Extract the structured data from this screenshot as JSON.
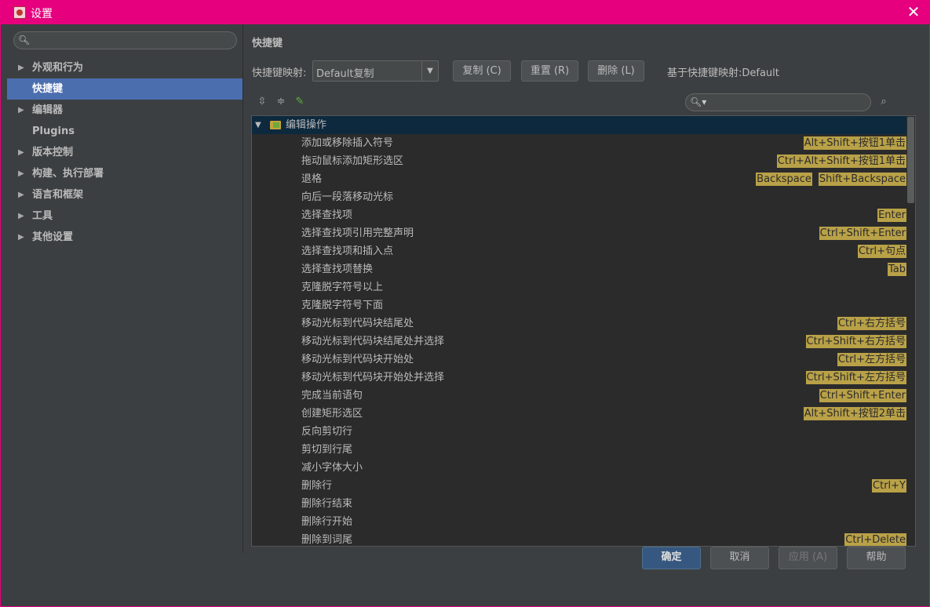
{
  "window": {
    "title": "设置"
  },
  "sidebar": {
    "search_placeholder": "",
    "items": [
      {
        "label": "外观和行为",
        "expandable": true
      },
      {
        "label": "快捷键",
        "expandable": false,
        "selected": true
      },
      {
        "label": "编辑器",
        "expandable": true
      },
      {
        "label": "Plugins",
        "expandable": false
      },
      {
        "label": "版本控制",
        "expandable": true
      },
      {
        "label": "构建、执行部署",
        "expandable": true
      },
      {
        "label": "语言和框架",
        "expandable": true
      },
      {
        "label": "工具",
        "expandable": true
      },
      {
        "label": "其他设置",
        "expandable": true
      }
    ]
  },
  "main": {
    "title": "快捷键",
    "keymap_label": "快捷键映射:",
    "keymap_value": "Default复制",
    "copy_label": "复制 (C)",
    "reset_label": "重置 (R)",
    "delete_label": "删除 (L)",
    "based_on": "基于快捷键映射:Default",
    "filter_placeholder": "",
    "tree": {
      "group": "编辑操作",
      "rows": [
        {
          "label": "添加或移除插入符号",
          "shortcuts": [
            "Alt+Shift+按钮1单击"
          ]
        },
        {
          "label": "拖动鼠标添加矩形选区",
          "shortcuts": [
            "Ctrl+Alt+Shift+按钮1单击"
          ]
        },
        {
          "label": "退格",
          "shortcuts": [
            "Backspace",
            "Shift+Backspace"
          ]
        },
        {
          "label": "向后一段落移动光标",
          "shortcuts": []
        },
        {
          "label": "选择查找项",
          "shortcuts": [
            "Enter"
          ]
        },
        {
          "label": "选择查找项引用完整声明",
          "shortcuts": [
            "Ctrl+Shift+Enter"
          ]
        },
        {
          "label": "选择查找项和插入点",
          "shortcuts": [
            "Ctrl+句点"
          ]
        },
        {
          "label": "选择查找项替换",
          "shortcuts": [
            "Tab"
          ]
        },
        {
          "label": "克隆脱字符号以上",
          "shortcuts": []
        },
        {
          "label": "克隆脱字符号下面",
          "shortcuts": []
        },
        {
          "label": "移动光标到代码块结尾处",
          "shortcuts": [
            "Ctrl+右方括号"
          ]
        },
        {
          "label": "移动光标到代码块结尾处并选择",
          "shortcuts": [
            "Ctrl+Shift+右方括号"
          ]
        },
        {
          "label": "移动光标到代码块开始处",
          "shortcuts": [
            "Ctrl+左方括号"
          ]
        },
        {
          "label": "移动光标到代码块开始处并选择",
          "shortcuts": [
            "Ctrl+Shift+左方括号"
          ]
        },
        {
          "label": "完成当前语句",
          "shortcuts": [
            "Ctrl+Shift+Enter"
          ]
        },
        {
          "label": "创建矩形选区",
          "shortcuts": [
            "Alt+Shift+按钮2单击"
          ]
        },
        {
          "label": "反向剪切行",
          "shortcuts": []
        },
        {
          "label": "剪切到行尾",
          "shortcuts": []
        },
        {
          "label": "减小字体大小",
          "shortcuts": []
        },
        {
          "label": "删除行",
          "shortcuts": [
            "Ctrl+Y"
          ]
        },
        {
          "label": "删除行结束",
          "shortcuts": []
        },
        {
          "label": "删除行开始",
          "shortcuts": []
        },
        {
          "label": "删除到词尾",
          "shortcuts": [
            "Ctrl+Delete"
          ]
        }
      ]
    }
  },
  "footer": {
    "ok_label": "确定",
    "cancel_label": "取消",
    "apply_label": "应用 (A)",
    "help_label": "帮助"
  },
  "colors": {
    "title_bar": "#e6007e",
    "selection": "#4b6eaf",
    "shortcut_badge": "#b9a147",
    "group_row": "#0d293e"
  },
  "icons": [
    "app-icon",
    "close-icon",
    "search-icon",
    "expand-all-icon",
    "collapse-all-icon",
    "edit-icon",
    "find-shortcut-icon",
    "folder-icon"
  ]
}
